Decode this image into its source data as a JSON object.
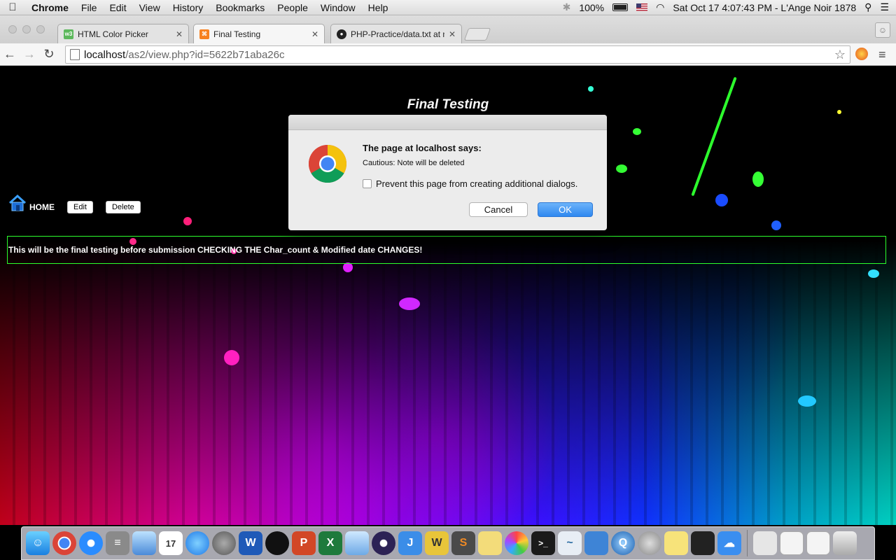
{
  "menubar": {
    "app_name": "Chrome",
    "items": [
      "File",
      "Edit",
      "View",
      "History",
      "Bookmarks",
      "People",
      "Window",
      "Help"
    ],
    "battery": "100%",
    "clock": "Sat Oct 17  4:07:43 PM - L'Ange Noir 1878"
  },
  "tabs": [
    {
      "label": "HTML Color Picker",
      "favicon": "w3-icon"
    },
    {
      "label": "Final Testing",
      "favicon": "xampp-icon"
    },
    {
      "label": "PHP-Practice/data.txt at m",
      "favicon": "github-icon"
    }
  ],
  "toolbar": {
    "url_host": "localhost",
    "url_path": "/as2/view.php?id=5622b71aba26c"
  },
  "page": {
    "title": "Final Testing",
    "home_label": "HOME",
    "edit_label": "Edit",
    "delete_label": "Delete",
    "note_text": "This will be the final testing before submission CHECKING THE Char_count & Modified date CHANGES!"
  },
  "dialog": {
    "heading": "The page at localhost says:",
    "message": "Cautious: Note will be deleted",
    "checkbox_label": "Prevent this page from creating additional dialogs.",
    "checkbox_checked": false,
    "cancel_label": "Cancel",
    "ok_label": "OK"
  },
  "dock": {
    "apps": [
      "finder",
      "chrome",
      "safari",
      "calculator",
      "preview",
      "calendar",
      "messages",
      "system-preferences",
      "word",
      "qq",
      "powerpoint",
      "excel",
      "box",
      "eclipse",
      "jira",
      "keychain",
      "sublime",
      "notes",
      "photos",
      "terminal",
      "mysql",
      "xcode",
      "quicktime",
      "settings",
      "stickies",
      "printer",
      "icloud",
      "zip",
      "window-manager",
      "finder-window",
      "trash"
    ]
  }
}
